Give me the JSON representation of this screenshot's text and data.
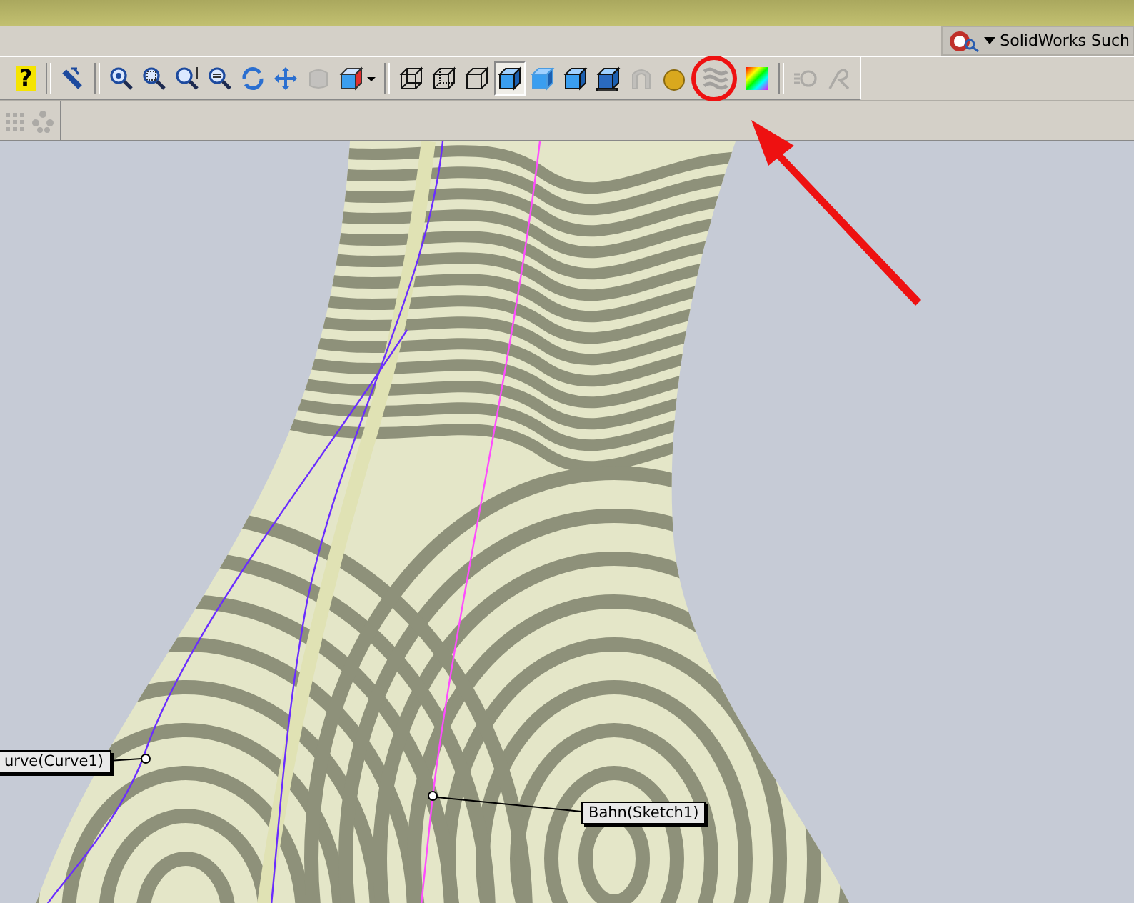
{
  "search": {
    "label": "SolidWorks Such"
  },
  "toolbar": {
    "groups": [
      {
        "buttons": [
          {
            "kind": "help",
            "label": "?",
            "selected": false,
            "disabled": false
          }
        ]
      },
      {
        "buttons": [
          {
            "kind": "select",
            "selected": false,
            "disabled": false
          }
        ]
      },
      {
        "buttons": [
          {
            "kind": "zoom-fit",
            "selected": false,
            "disabled": false
          },
          {
            "kind": "zoom-area",
            "selected": false,
            "disabled": false
          },
          {
            "kind": "zoom-in-out",
            "selected": false,
            "disabled": false
          },
          {
            "kind": "zoom-selection",
            "selected": false,
            "disabled": false
          },
          {
            "kind": "rotate",
            "selected": false,
            "disabled": false
          },
          {
            "kind": "pan",
            "selected": false,
            "disabled": false
          },
          {
            "kind": "view-3d",
            "selected": false,
            "disabled": true
          },
          {
            "kind": "view-orientation",
            "selected": false,
            "disabled": false
          }
        ]
      },
      {
        "buttons": [
          {
            "kind": "wireframe",
            "selected": false,
            "disabled": false
          },
          {
            "kind": "hidden-visible",
            "selected": false,
            "disabled": false
          },
          {
            "kind": "hidden-removed",
            "selected": false,
            "disabled": false
          },
          {
            "kind": "shaded-edges",
            "selected": true,
            "disabled": false
          },
          {
            "kind": "shaded",
            "selected": false,
            "disabled": false
          },
          {
            "kind": "section",
            "selected": false,
            "disabled": false
          },
          {
            "kind": "shadow",
            "selected": false,
            "disabled": false
          },
          {
            "kind": "perspective",
            "selected": false,
            "disabled": true
          },
          {
            "kind": "realview",
            "selected": false,
            "disabled": false
          },
          {
            "kind": "zebra",
            "selected": false,
            "disabled": true
          },
          {
            "kind": "curvature",
            "selected": false,
            "disabled": false
          }
        ]
      },
      {
        "buttons": [
          {
            "kind": "draft",
            "selected": false,
            "disabled": true
          },
          {
            "kind": "undercut",
            "selected": false,
            "disabled": true
          }
        ]
      }
    ]
  },
  "secondary_toolbar": [
    {
      "kind": "grid",
      "disabled": true
    },
    {
      "kind": "dots",
      "disabled": true
    }
  ],
  "callouts": [
    {
      "label": "urve(Curve1)"
    },
    {
      "label": "Bahn(Sketch1)"
    }
  ]
}
